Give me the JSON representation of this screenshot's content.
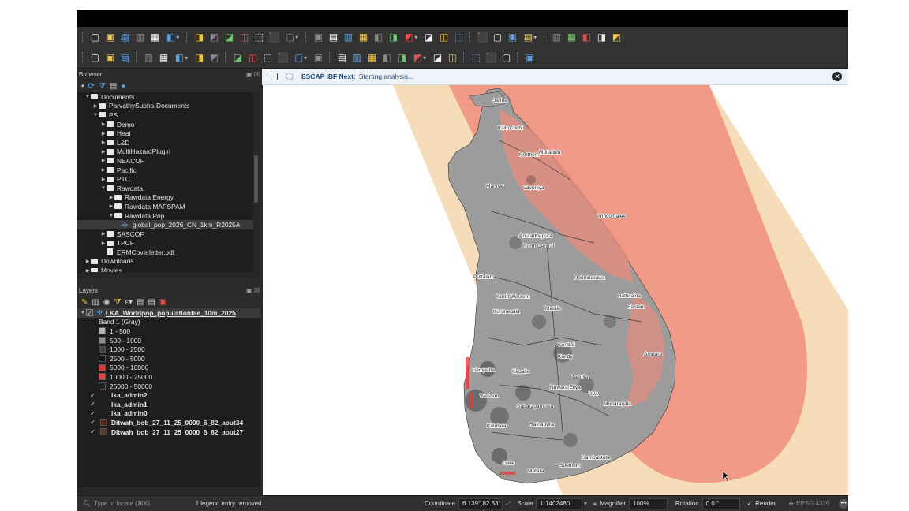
{
  "toolbar": {
    "row1_icons": [
      "new-project",
      "open-project",
      "save-project",
      "save-as",
      "print-layout",
      "style-manager",
      "pan",
      "pan-to-selection",
      "zoom-in",
      "zoom-out",
      "zoom-full",
      "zoom-layer",
      "zoom-selection",
      "zoom-last",
      "zoom-next",
      "new-map-view",
      "new-3d-view",
      "bookmarks",
      "show-bookmarks",
      "temporal",
      "refresh",
      "attribute-table",
      "select-features",
      "deselect",
      "identify",
      "measure",
      "statistics",
      "sum",
      "field-calculator",
      "measure-line",
      "map-tips",
      "annotation"
    ],
    "row2_icons": [
      "data-source-manager",
      "new-layer",
      "digitize",
      "edit",
      "save-edits",
      "add-point",
      "vertex-tool",
      "move-feature",
      "delete",
      "cut",
      "copy",
      "paste",
      "undo",
      "redo",
      "label",
      "pin-labels",
      "show-hide-labels",
      "move-label",
      "rotate-label",
      "change-label",
      "label-properties",
      "diagram",
      "python",
      "plugin",
      "plugin-b",
      "help"
    ]
  },
  "browser": {
    "title": "Browser",
    "items": [
      {
        "label": "Documents",
        "depth": 0,
        "expanded": true,
        "kind": "folder"
      },
      {
        "label": "ParvathySubha-Documents",
        "depth": 1,
        "expanded": false,
        "kind": "folder"
      },
      {
        "label": "PS",
        "depth": 1,
        "expanded": true,
        "kind": "folder"
      },
      {
        "label": "Demo",
        "depth": 2,
        "expanded": false,
        "kind": "folder"
      },
      {
        "label": "Heat",
        "depth": 2,
        "expanded": false,
        "kind": "folder"
      },
      {
        "label": "L&D",
        "depth": 2,
        "expanded": false,
        "kind": "folder"
      },
      {
        "label": "MultiHazardPlugin",
        "depth": 2,
        "expanded": false,
        "kind": "folder"
      },
      {
        "label": "NEACOF",
        "depth": 2,
        "expanded": false,
        "kind": "folder"
      },
      {
        "label": "Pacific",
        "depth": 2,
        "expanded": false,
        "kind": "folder"
      },
      {
        "label": "PTC",
        "depth": 2,
        "expanded": false,
        "kind": "folder"
      },
      {
        "label": "Rawdata",
        "depth": 2,
        "expanded": true,
        "kind": "folder"
      },
      {
        "label": "Rawdata Energy",
        "depth": 3,
        "expanded": false,
        "kind": "folder"
      },
      {
        "label": "Rawdata MAPSPAM",
        "depth": 3,
        "expanded": false,
        "kind": "folder"
      },
      {
        "label": "Rawdata Pop",
        "depth": 3,
        "expanded": true,
        "kind": "folder"
      },
      {
        "label": "global_pop_2026_CN_1km_R2025A",
        "depth": 4,
        "expanded": false,
        "kind": "raster",
        "selected": true
      },
      {
        "label": "SASCOF",
        "depth": 2,
        "expanded": false,
        "kind": "folder"
      },
      {
        "label": "TPCF",
        "depth": 2,
        "expanded": false,
        "kind": "folder"
      },
      {
        "label": "ERMCoverletter.pdf",
        "depth": 2,
        "expanded": false,
        "kind": "doc"
      },
      {
        "label": "Downloads",
        "depth": 0,
        "expanded": false,
        "kind": "folder"
      },
      {
        "label": "Movies",
        "depth": 0,
        "expanded": false,
        "kind": "folder"
      }
    ]
  },
  "layers": {
    "title": "Layers",
    "main_layer": "LKA_Worldpop_populationfile_10m_2025",
    "band_label": "Band 1 (Gray)",
    "legend": [
      {
        "label": "1 - 500",
        "color": "#b5b5b5"
      },
      {
        "label": "500 - 1000",
        "color": "#8c8c8c"
      },
      {
        "label": "1000 - 2500",
        "color": "#454545"
      },
      {
        "label": "2500 - 5000",
        "color": "#111111"
      },
      {
        "label": "5000 - 10000",
        "color": "#d63a3a"
      },
      {
        "label": "10000 - 25000",
        "color": "#e24545"
      },
      {
        "label": "25000 - 50000",
        "color": "#1e1e1e"
      }
    ],
    "other_layers": [
      {
        "label": "lka_admin2",
        "swatch": ""
      },
      {
        "label": "lka_admin1",
        "swatch": ""
      },
      {
        "label": "lka_admin0",
        "swatch": ""
      },
      {
        "label": "Ditwah_bob_27_11_25_0000_6_82_aout34",
        "swatch": "#5a1f1f"
      },
      {
        "label": "Ditwah_bob_27_11_25_0000_6_82_aout27",
        "swatch": "#5a3a2e"
      }
    ]
  },
  "message": {
    "plugin": "ESCAP IBF Next:",
    "text": "Starting analysis..."
  },
  "map": {
    "places": [
      "Jaffna",
      "Kilinochchi",
      "Northern",
      "Mullaitivu",
      "Mannar",
      "Vavuniya",
      "Trincomalee",
      "Anuradhapura",
      "North Central",
      "Puttalam",
      "Polonnaruwa",
      "North Western",
      "Batticaloa",
      "Kurunegala",
      "Matale",
      "Eastern",
      "Central",
      "Kandy",
      "Ampara",
      "Gampaha",
      "Kegalle",
      "Badulla",
      "Western",
      "Nuwara Eliya",
      "Uva",
      "Sabaragamuwa",
      "Monaragala",
      "Kalutara",
      "Ratnapura",
      "Hambantota",
      "Galle",
      "Matara",
      "Southern"
    ],
    "colors": {
      "outer_band": "#f6dcb8",
      "inner_band": "#f19a87",
      "island_gray": "#9a9a9a"
    }
  },
  "statusbar": {
    "locate_placeholder": "Type to locate (⌘K)",
    "message": "1 legend entry removed.",
    "coordinate_label": "Coordinate",
    "coordinate_value": "6.139°,82.33°",
    "scale_label": "Scale",
    "scale_value": "1:1402480",
    "magnifier_label": "Magnifier",
    "magnifier_value": "100%",
    "rotation_label": "Rotation",
    "rotation_value": "0.0 °",
    "render_label": "Render",
    "crs_label": "EPSG:4326"
  }
}
